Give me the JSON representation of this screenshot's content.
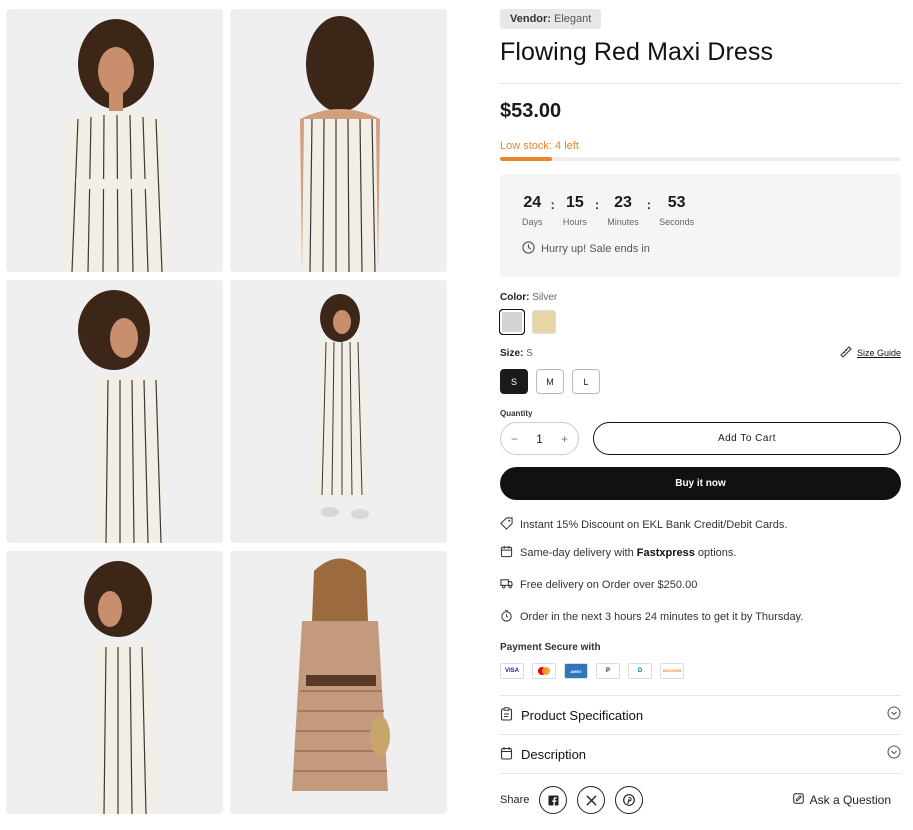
{
  "vendor": {
    "label": "Vendor:",
    "value": "Elegant"
  },
  "product": {
    "title": "Flowing Red Maxi Dress",
    "price": "$53.00"
  },
  "stock": {
    "text": "Low stock: 4 left",
    "fraction": 0.13,
    "color": "#e8862e"
  },
  "countdown": {
    "units": [
      {
        "value": "24",
        "label": "Days"
      },
      {
        "value": "15",
        "label": "Hours"
      },
      {
        "value": "23",
        "label": "Minutes"
      },
      {
        "value": "53",
        "label": "Seconds"
      }
    ],
    "separator": ":",
    "message": "Hurry up! Sale ends in"
  },
  "color_option": {
    "label": "Color:",
    "selected": "Silver",
    "swatches": [
      {
        "name": "Silver",
        "hex": "#d4d4d4"
      },
      {
        "name": "Beige",
        "hex": "#e6d6a6"
      }
    ]
  },
  "size_option": {
    "label": "Size:",
    "selected": "S",
    "sizes": [
      "S",
      "M",
      "L"
    ],
    "guide": "Size Guide"
  },
  "quantity": {
    "label": "Quantity",
    "value": "1",
    "minus": "−",
    "plus": "+"
  },
  "actions": {
    "add_to_cart": "Add To Cart",
    "buy_now": "Buy it now"
  },
  "features": [
    {
      "icon": "tag-icon",
      "text": "Instant 15% Discount on EKL Bank Credit/Debit Cards."
    },
    {
      "icon": "calendar-icon",
      "text_before": "Same-day delivery with ",
      "bold": "Fastxpress",
      "text_after": " options."
    },
    {
      "icon": "truck-icon",
      "text": "Free delivery on Order over $250.00"
    },
    {
      "icon": "stopwatch-icon",
      "text": "Order in the next 3 hours 24 minutes to get it by Thursday."
    }
  ],
  "payment": {
    "label": "Payment Secure with",
    "cards": [
      {
        "name": "visa-card-icon",
        "text": "VISA",
        "color": "#1a1f71"
      },
      {
        "name": "mastercard-icon",
        "text": "",
        "color": "#eb001b"
      },
      {
        "name": "amex-card-icon",
        "text": "AMEX",
        "color": "#2e77bb"
      },
      {
        "name": "paypal-card-icon",
        "text": "P",
        "color": "#003087"
      },
      {
        "name": "diners-card-icon",
        "text": "D",
        "color": "#0079be"
      },
      {
        "name": "discover-card-icon",
        "text": "DISCOVER",
        "color": "#f58220"
      }
    ]
  },
  "accordions": [
    {
      "label": "Product Specification"
    },
    {
      "label": "Description"
    }
  ],
  "share": {
    "label": "Share",
    "networks": [
      "facebook-icon",
      "x-icon",
      "pinterest-icon"
    ]
  },
  "ask": {
    "label": "Ask a Question"
  }
}
